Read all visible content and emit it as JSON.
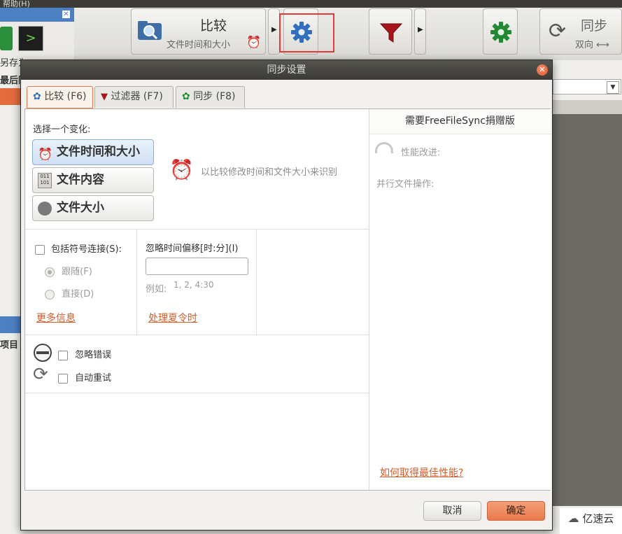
{
  "menubar": {
    "text": "帮助(H)"
  },
  "main_toolbar": {
    "compare": {
      "label": "比较",
      "sublabel": "文件时间和大小"
    },
    "sync": {
      "label": "同步",
      "sublabel": "双向 ⟷"
    }
  },
  "left_panel": {
    "label_top": "另存为",
    "label_bottom": "最后同",
    "label_items": "项目"
  },
  "dialog": {
    "title": "同步设置",
    "tabs": [
      {
        "label": "比较 (F6)"
      },
      {
        "label": "过滤器 (F7)"
      },
      {
        "label": "同步 (F8)"
      }
    ],
    "compare": {
      "heading": "选择一个变化:",
      "variants": [
        {
          "label": "文件时间和大小"
        },
        {
          "label": "文件内容"
        },
        {
          "label": "文件大小"
        }
      ],
      "description": "以比较修改时间和文件大小来识别",
      "symlink_label": "包括符号连接(S):",
      "follow_label": "跟随(F)",
      "direct_label": "直接(D)",
      "more_info_link": "更多信息",
      "time_shift_label": "忽略时间偏移[时:分](I)",
      "time_shift_value": "",
      "example_label": "例如:",
      "example_value": "1, 2, 4:30",
      "dst_link": "处理夏令时",
      "ignore_errors_label": "忽略错误",
      "auto_retry_label": "自动重试"
    },
    "right_pane": {
      "header": "需要FreeFileSync捐赠版",
      "performance_label": "性能改进:",
      "parallel_label": "并行文件操作:",
      "best_perf_link": "如何取得最佳性能?"
    },
    "buttons": {
      "cancel": "取消",
      "ok": "确定"
    }
  },
  "watermark": {
    "text": "亿速云"
  },
  "colors": {
    "accent": "#e9794a",
    "link": "#d35c2a",
    "highlight_box": "#e03c3c"
  }
}
